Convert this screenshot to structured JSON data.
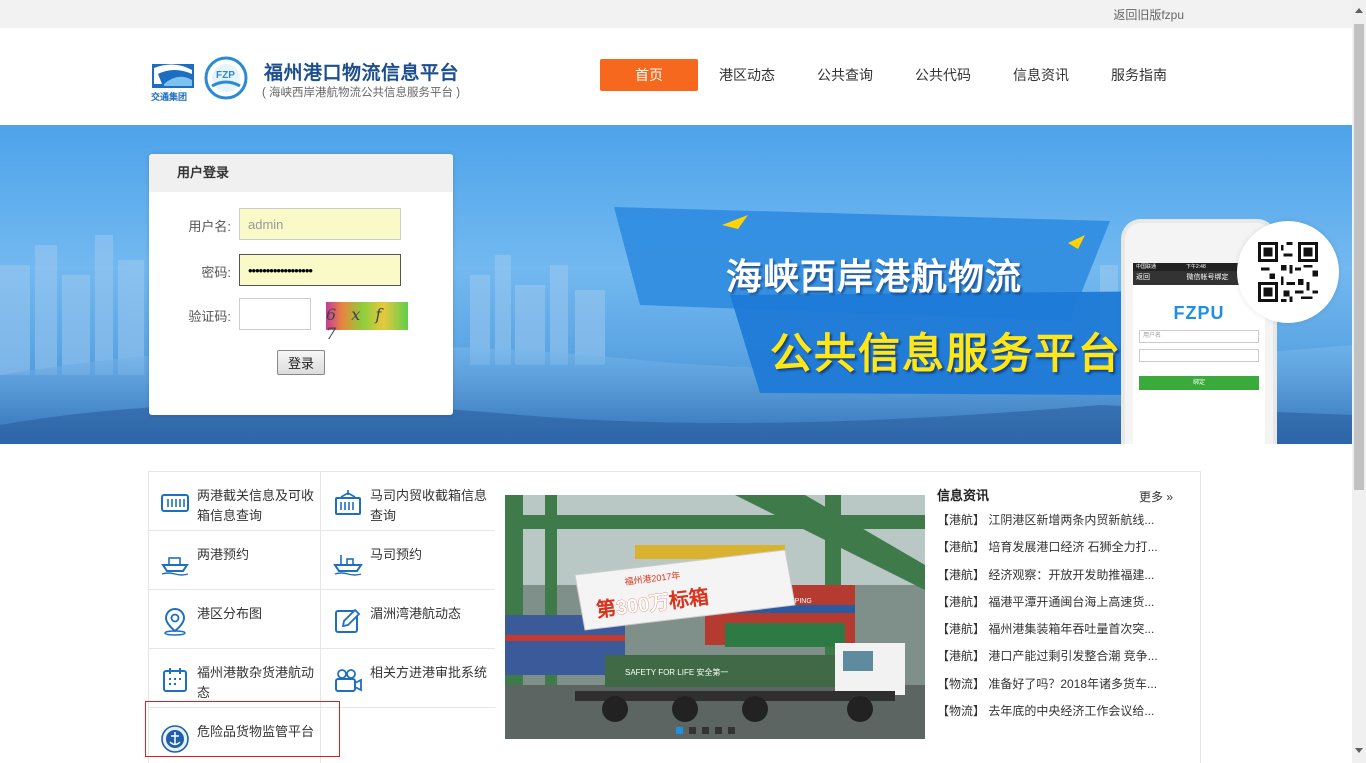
{
  "topbar": {
    "old_version_link": "返回旧版fzpu"
  },
  "header": {
    "logo_text": "交通集团",
    "logo2_text": "FZP",
    "title": "福州港口物流信息平台",
    "subtitle": "( 海峡西岸港航物流公共信息服务平台 )"
  },
  "nav": {
    "items": [
      "首页",
      "港区动态",
      "公共查询",
      "公共代码",
      "信息资讯",
      "服务指南"
    ],
    "active": "首页"
  },
  "login": {
    "title": "用户登录",
    "username_label": "用户名:",
    "username_value": "admin",
    "password_label": "密码:",
    "password_value": "••••••••••••••••••",
    "captcha_label": "验证码:",
    "captcha_value": "",
    "captcha_text": "6 x f 7",
    "submit_label": "登录"
  },
  "banner": {
    "slogan_line1": "海峡西岸港航物流",
    "slogan_line2": "公共信息服务平台",
    "phone": {
      "status_left": "中国联通",
      "status_center": "下午2:48",
      "back": "返回",
      "title": "微信帐号绑定",
      "brand": "FZPU",
      "input_user": "用户名",
      "bind_button": "绑定"
    }
  },
  "services": [
    {
      "label": "两港截关信息及可收箱信息查询",
      "icon": "container-icon"
    },
    {
      "label": "马司内贸收截箱信息查询",
      "icon": "container-crane-icon"
    },
    {
      "label": "两港预约",
      "icon": "ship-icon"
    },
    {
      "label": "马司预约",
      "icon": "cargo-ship-icon"
    },
    {
      "label": "港区分布图",
      "icon": "map-pin-icon"
    },
    {
      "label": "湄洲湾港航动态",
      "icon": "edit-icon"
    },
    {
      "label": "福州港散杂货港航动态",
      "icon": "calendar-icon"
    },
    {
      "label": "相关方进港审批系统",
      "icon": "video-camera-icon"
    },
    {
      "label": "危险品货物监管平台",
      "icon": "maritime-emblem-icon"
    }
  ],
  "slider": {
    "caption_small": "福州港2017年",
    "caption_big_pre": "第",
    "caption_big_num": "300万",
    "caption_big_post": "标箱",
    "truck_text": "SAFETY FOR LIFE 安全第一",
    "shipping_text": "CHINA SHIPPING",
    "active_dot": 0,
    "dot_count": 5
  },
  "news": {
    "title": "信息资讯",
    "more": "更多 »",
    "items": [
      "【港航】 江阴港区新增两条内贸新航线...",
      "【港航】 培育发展港口经济 石狮全力打...",
      "【港航】 经济观察：开放开发助推福建...",
      "【港航】 福港平潭开通闽台海上高速货...",
      "【港航】 福州港集装箱年吞吐量首次突...",
      "【港航】 港口产能过剩引发整合潮 竞争...",
      "【物流】 准备好了吗？2018年诸多货车...",
      "【物流】 去年底的中央经济工作会议给..."
    ]
  },
  "colors": {
    "accent": "#f5681d",
    "brand_blue": "#1d4f8f",
    "slogan_yellow": "#ffe617",
    "highlight_red": "#d9211e"
  }
}
